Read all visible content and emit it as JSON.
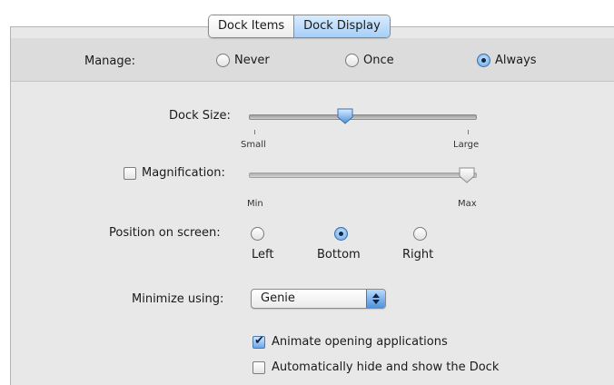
{
  "tabs": [
    {
      "label": "Dock Items",
      "selected": false
    },
    {
      "label": "Dock Display",
      "selected": true
    }
  ],
  "manage": {
    "label": "Manage:",
    "options": [
      {
        "label": "Never",
        "selected": false
      },
      {
        "label": "Once",
        "selected": false
      },
      {
        "label": "Always",
        "selected": true
      }
    ]
  },
  "dock_size": {
    "label": "Dock Size:",
    "min_label": "Small",
    "max_label": "Large",
    "value_fraction": 0.42
  },
  "magnification": {
    "label": "Magnification:",
    "checked": false,
    "min_label": "Min",
    "max_label": "Max",
    "value_fraction": 1.0
  },
  "position": {
    "label": "Position on screen:",
    "options": [
      {
        "label": "Left",
        "selected": false
      },
      {
        "label": "Bottom",
        "selected": true
      },
      {
        "label": "Right",
        "selected": false
      }
    ]
  },
  "minimize": {
    "label": "Minimize using:",
    "value": "Genie"
  },
  "checkboxes": {
    "animate": {
      "label": "Animate opening applications",
      "checked": true
    },
    "autohide": {
      "label": "Automatically hide and show the Dock",
      "checked": false
    }
  },
  "colors": {
    "accent": "#5fa2e6",
    "panel_bg": "#e8e8e8"
  }
}
